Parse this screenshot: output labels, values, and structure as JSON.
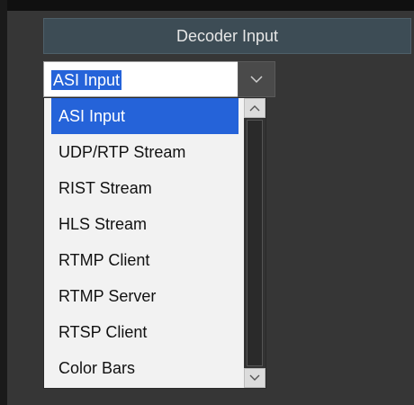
{
  "section": {
    "title": "Decoder Input"
  },
  "combo": {
    "value": "ASI Input",
    "button_icon": "chevron-down-icon"
  },
  "dropdown": {
    "options": [
      "ASI Input",
      "UDP/RTP Stream",
      "RIST Stream",
      "HLS Stream",
      "RTMP Client",
      "RTMP Server",
      "RTSP Client",
      "Color Bars"
    ],
    "selected": "ASI Input",
    "scroll_up_icon": "chevron-up-icon",
    "scroll_down_icon": "chevron-down-icon"
  },
  "colors": {
    "selection": "#2563d9",
    "panel": "#363636",
    "header": "#3d4c55"
  }
}
